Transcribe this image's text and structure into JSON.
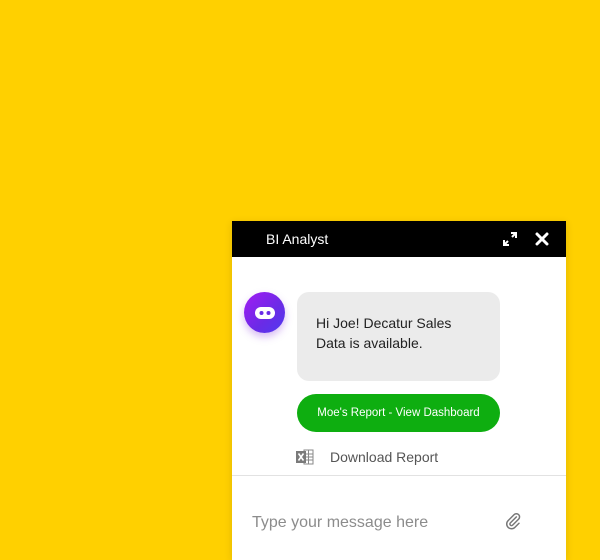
{
  "header": {
    "title": "BI Analyst",
    "expand_icon": "expand-icon",
    "close_icon": "close-icon"
  },
  "conversation": {
    "bot_avatar_icon": "bot-face-icon",
    "message": "Hi Joe! Decatur Sales Data is available.",
    "action_button_label": "Moe's Report - View Dashboard",
    "download": {
      "icon": "excel-file-icon",
      "label": "Download Report"
    }
  },
  "composer": {
    "placeholder": "Type your message here",
    "value": "",
    "attach_icon": "paperclip-icon"
  },
  "colors": {
    "page_background": "#FFD000",
    "header_background": "#000000",
    "bubble_background": "#EBEBEB",
    "action_button": "#0EAE10",
    "avatar_gradient_start": "#A21CF3",
    "avatar_gradient_end": "#4F3AF0"
  }
}
